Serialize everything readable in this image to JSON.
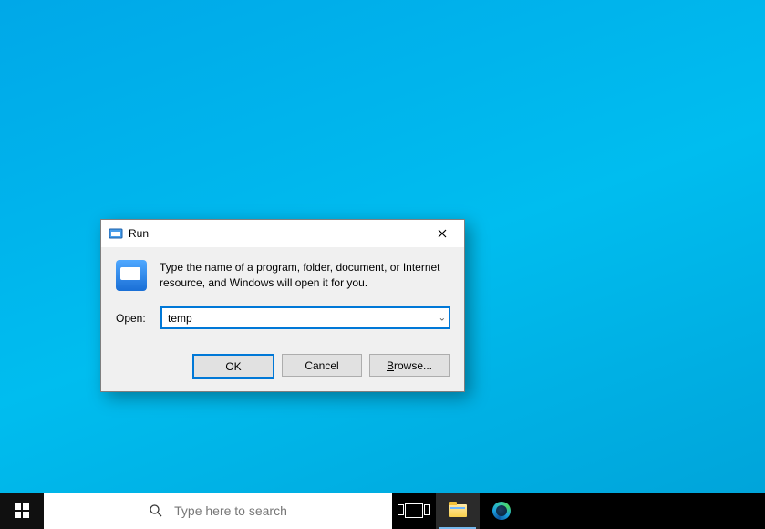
{
  "dialog": {
    "title": "Run",
    "description": "Type the name of a program, folder, document, or Internet resource, and Windows will open it for you.",
    "open_label": "Open:",
    "open_value": "temp",
    "buttons": {
      "ok": "OK",
      "cancel": "Cancel",
      "browse_prefix": "B",
      "browse_rest": "rowse..."
    }
  },
  "taskbar": {
    "search_placeholder": "Type here to search"
  }
}
